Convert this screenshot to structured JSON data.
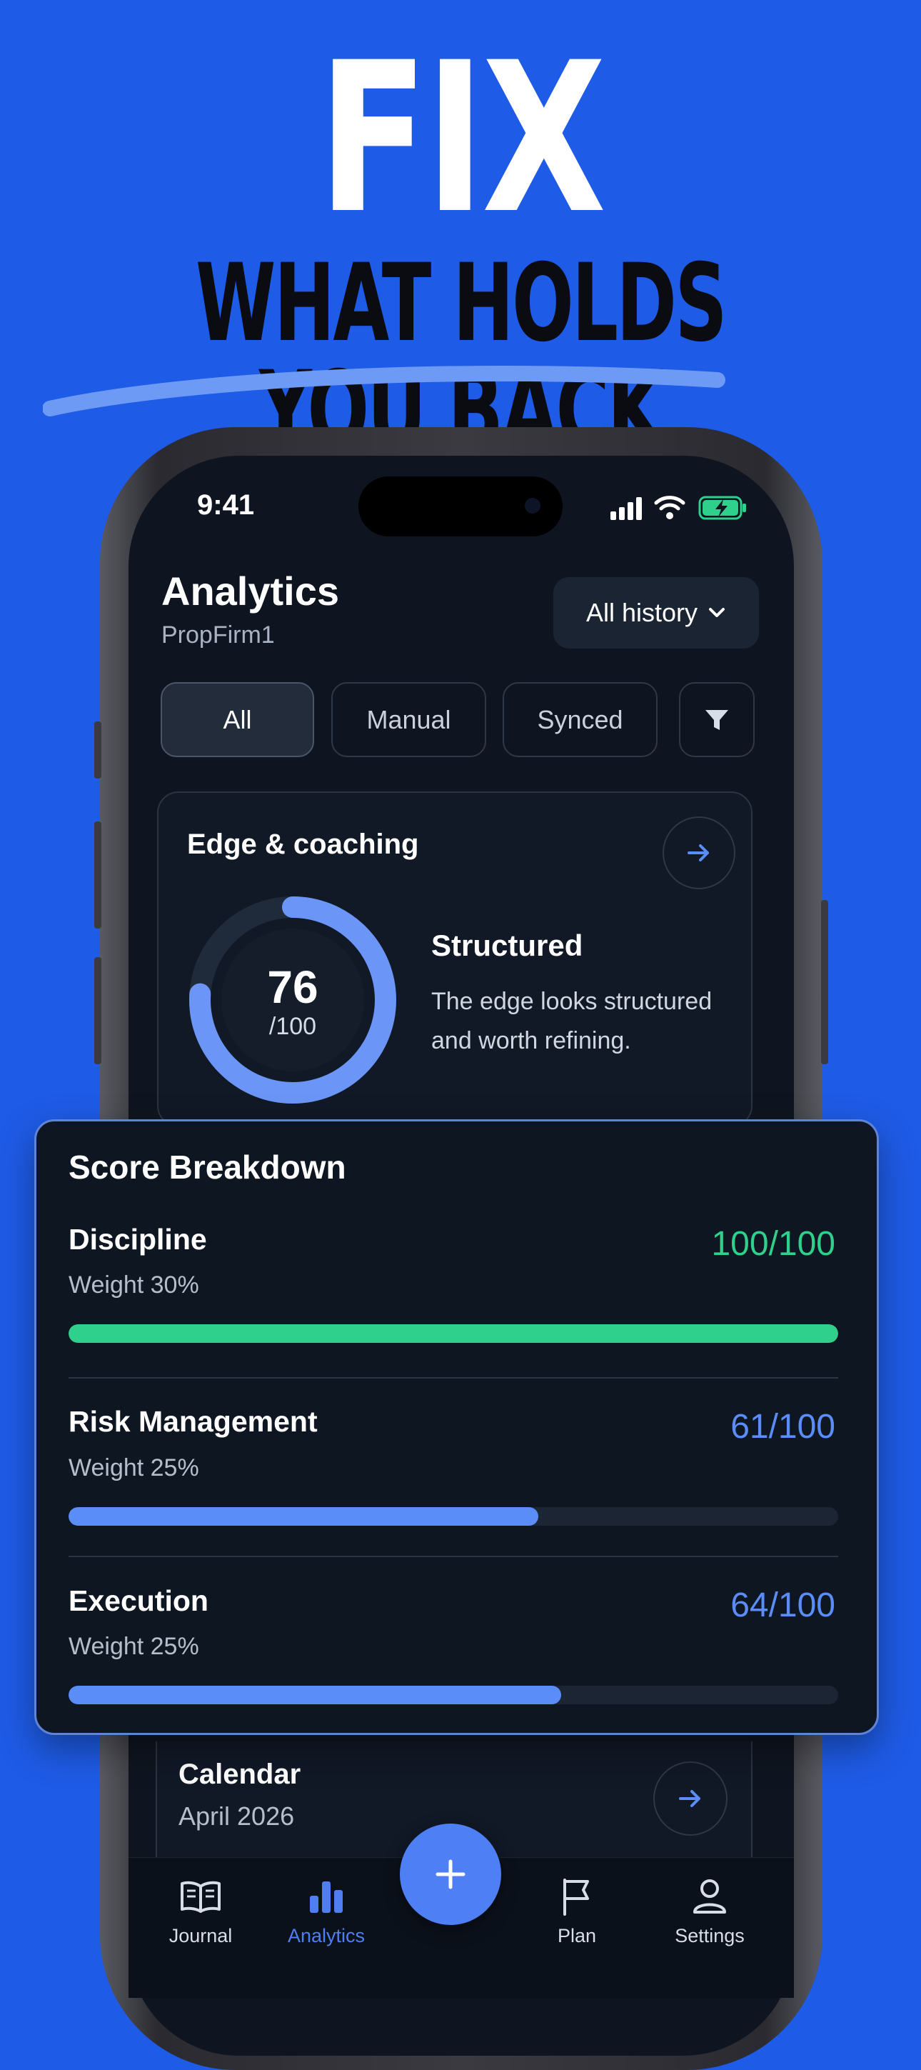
{
  "headline": {
    "line1": "FIX",
    "line2": "WHAT HOLDS YOU BACK"
  },
  "status_bar": {
    "time": "9:41",
    "icons": [
      "signal-icon",
      "wifi-icon",
      "battery-charging-icon"
    ]
  },
  "header": {
    "title": "Analytics",
    "subtitle": "PropFirm1",
    "history_select": "All history"
  },
  "filters": {
    "tabs": [
      {
        "label": "All",
        "active": true
      },
      {
        "label": "Manual",
        "active": false
      },
      {
        "label": "Synced",
        "active": false
      }
    ],
    "filter_icon": "filter-icon"
  },
  "edge_card": {
    "title": "Edge & coaching",
    "score": "76",
    "score_max": "/100",
    "score_value": 76,
    "status": "Structured",
    "description": "The edge looks structured and worth refining."
  },
  "breakdown": {
    "title": "Score Breakdown",
    "items": [
      {
        "label": "Discipline",
        "weight": "Weight 30%",
        "value": "100/100",
        "score": 100,
        "color": "#2ed08b"
      },
      {
        "label": "Risk Management",
        "weight": "Weight 25%",
        "value": "61/100",
        "score": 61,
        "color": "#5a8df7"
      },
      {
        "label": "Execution",
        "weight": "Weight 25%",
        "value": "64/100",
        "score": 64,
        "color": "#5a8df7"
      }
    ]
  },
  "calendar": {
    "title": "Calendar",
    "subtitle": "April 2026"
  },
  "tabbar": {
    "items": [
      {
        "label": "Journal",
        "icon": "book-icon",
        "active": false
      },
      {
        "label": "Analytics",
        "icon": "bar-chart-icon",
        "active": true
      },
      {
        "label": "Plan",
        "icon": "flag-icon",
        "active": false
      },
      {
        "label": "Settings",
        "icon": "user-icon",
        "active": false
      }
    ],
    "add_icon": "plus-icon"
  },
  "colors": {
    "background": "#1e5be6",
    "accent": "#4f7df2",
    "success": "#2ed08b"
  }
}
